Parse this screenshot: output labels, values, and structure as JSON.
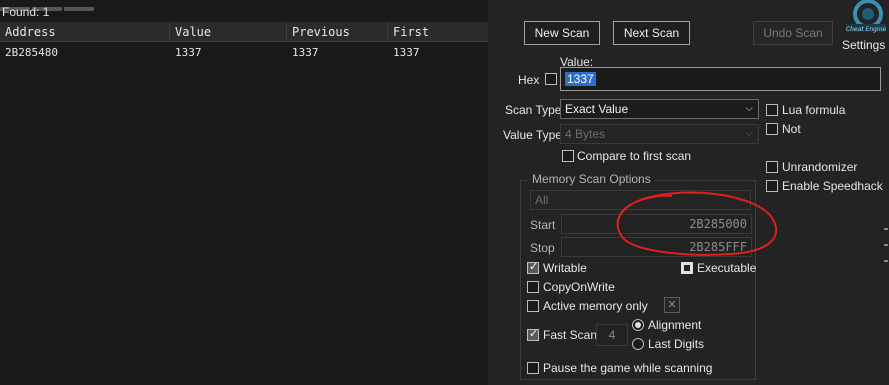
{
  "found_label": "Found: 1",
  "table": {
    "columns": [
      "Address",
      "Value",
      "Previous",
      "First"
    ],
    "rows": [
      {
        "address": "2B285480",
        "value": "1337",
        "previous": "1337",
        "first": "1337"
      }
    ]
  },
  "buttons": {
    "new_scan": "New Scan",
    "next_scan": "Next Scan",
    "undo_scan": "Undo Scan"
  },
  "settings_label": "Settings",
  "logo_text": "Cheat Engine",
  "value_label": "Value:",
  "hex_label": "Hex",
  "value_input": "1337",
  "scan_type": {
    "label": "Scan Type",
    "selected": "Exact Value"
  },
  "value_type": {
    "label": "Value Type",
    "selected": "4 Bytes"
  },
  "compare_first": "Compare to first scan",
  "right_options": {
    "lua_formula": "Lua formula",
    "not": "Not",
    "unrandomizer": "Unrandomizer",
    "enable_speedhack": "Enable Speedhack"
  },
  "memory_scan": {
    "title": "Memory Scan Options",
    "region": "All",
    "start_label": "Start",
    "start_value": "2B285000",
    "stop_label": "Stop",
    "stop_value": "2B285FFF",
    "writable": "Writable",
    "executable": "Executable",
    "copy_on_write": "CopyOnWrite",
    "active_memory_only": "Active memory only",
    "fast_scan": "Fast Scan",
    "fast_scan_value": "4",
    "alignment": "Alignment",
    "last_digits": "Last Digits",
    "pause_game": "Pause the game while scanning"
  },
  "colors": {
    "annotation": "#e02020",
    "selection": "#2a6fc9"
  }
}
